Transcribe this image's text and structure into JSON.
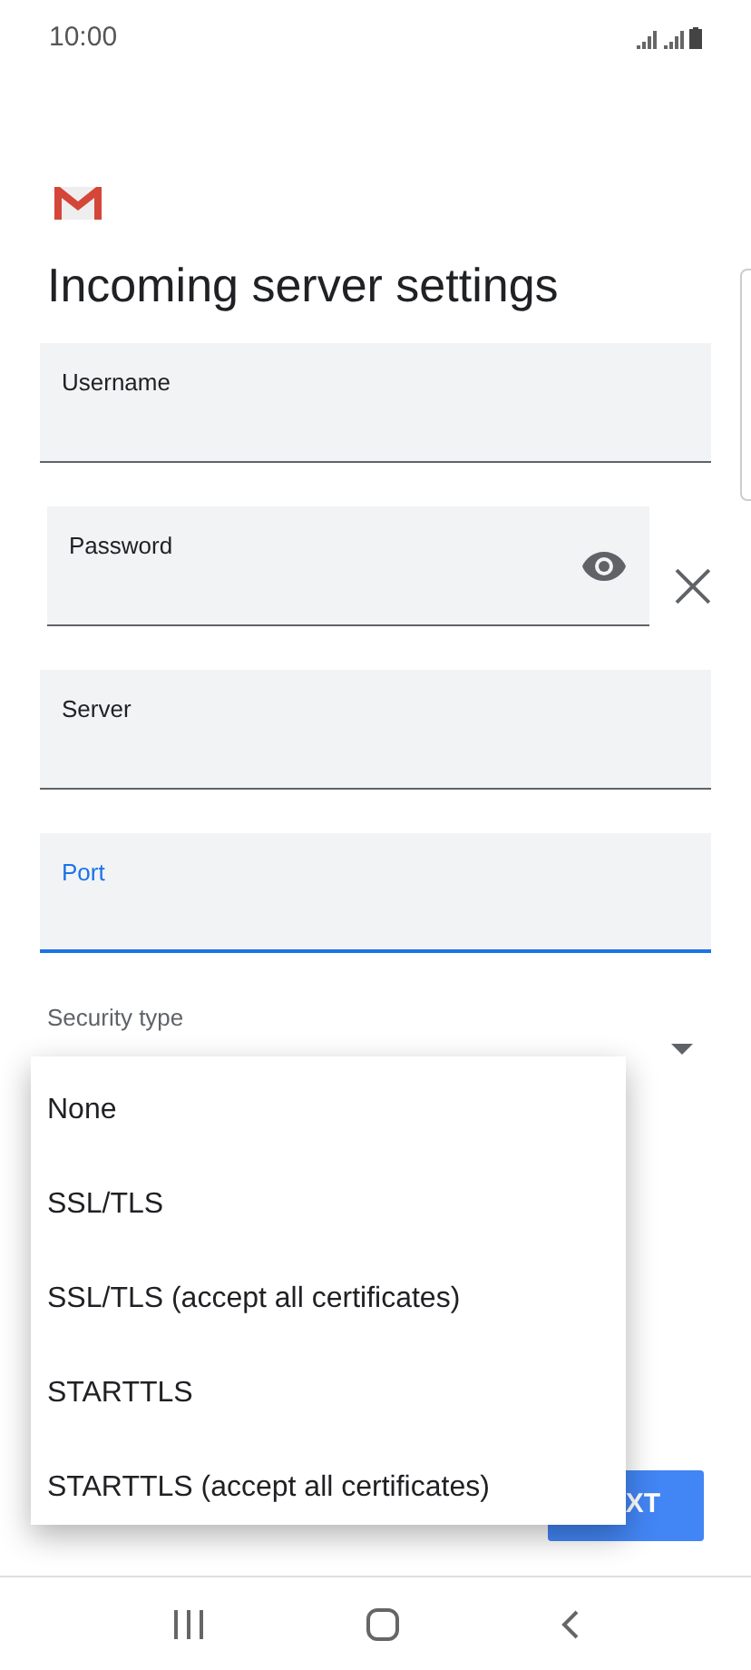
{
  "status_bar": {
    "time": "10:00"
  },
  "title": "Incoming server settings",
  "fields": [
    {
      "kind": "text",
      "label": "Username",
      "focused": false
    },
    {
      "kind": "password",
      "label": "Password",
      "focused": false
    },
    {
      "kind": "text",
      "label": "Server",
      "focused": false
    },
    {
      "kind": "text",
      "label": "Port",
      "focused": true
    }
  ],
  "security_type": {
    "label": "Security type"
  },
  "menu": {
    "items": [
      "None",
      "SSL/TLS",
      "SSL/TLS (accept all certificates)",
      "STARTTLS",
      "STARTTLS (accept all certificates)"
    ]
  },
  "next_button": {
    "label": "XT"
  }
}
